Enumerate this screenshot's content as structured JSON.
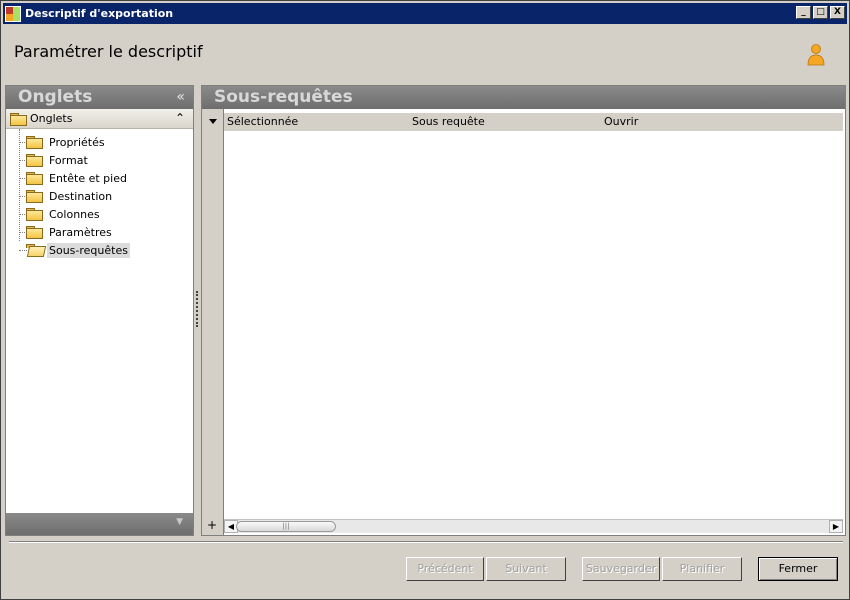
{
  "window": {
    "title": "Descriptif d'exportation",
    "controls": {
      "minimize": "_",
      "maximize": "□",
      "close": "X"
    }
  },
  "header": {
    "title": "Paramétrer le descriptif",
    "icon": "user-icon",
    "accent": "#f5a623"
  },
  "left_panel": {
    "title": "Onglets",
    "collapse_glyph": "«",
    "root": {
      "label": "Onglets",
      "chevron": "⌃"
    },
    "items": [
      {
        "label": "Propriétés"
      },
      {
        "label": "Format"
      },
      {
        "label": "Entête et pied"
      },
      {
        "label": "Destination"
      },
      {
        "label": "Colonnes"
      },
      {
        "label": "Paramètres"
      },
      {
        "label": "Sous-requêtes",
        "selected": true
      }
    ]
  },
  "right_panel": {
    "title": "Sous-requêtes",
    "columns": [
      "Sélectionnée",
      "Sous requête",
      "Ouvrir"
    ],
    "rows": [],
    "add_glyph": "+"
  },
  "buttons": {
    "previous": {
      "label": "Précédent",
      "enabled": false
    },
    "next": {
      "label": "Suivant",
      "enabled": false
    },
    "save": {
      "label": "Sauvegarder",
      "enabled": false
    },
    "schedule": {
      "label": "Planifier",
      "enabled": false
    },
    "close": {
      "label": "Fermer",
      "enabled": true
    }
  }
}
